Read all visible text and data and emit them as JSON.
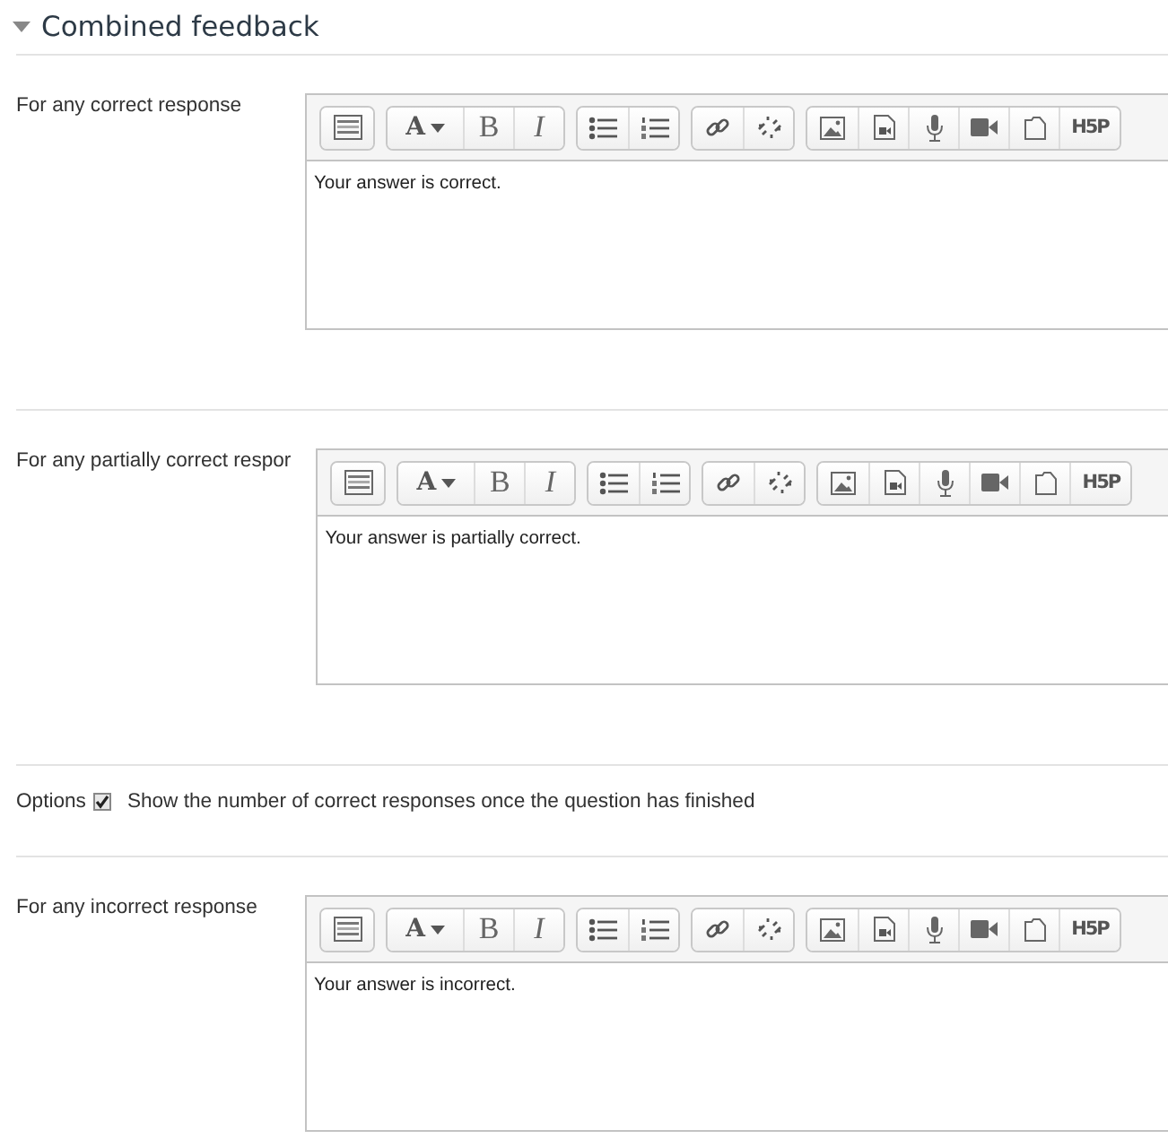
{
  "section": {
    "title": "Combined feedback",
    "expanded": true
  },
  "rows": [
    {
      "kind": "editor",
      "label": "For any correct response",
      "text": "Your answer is correct.",
      "toolbar": [
        [
          {
            "kind": "more"
          }
        ],
        [
          {
            "kind": "font",
            "label": "A"
          },
          {
            "kind": "bold",
            "label": "B"
          },
          {
            "kind": "italic",
            "label": "I"
          }
        ],
        [
          {
            "kind": "bullets"
          },
          {
            "kind": "numbers"
          }
        ],
        [
          {
            "kind": "link"
          },
          {
            "kind": "unlink"
          }
        ],
        [
          {
            "kind": "image"
          },
          {
            "kind": "media"
          },
          {
            "kind": "mic"
          },
          {
            "kind": "video"
          },
          {
            "kind": "files"
          },
          {
            "kind": "h5p",
            "label": "H5P"
          }
        ]
      ]
    },
    {
      "kind": "editor",
      "label": "For any partially correct respor",
      "text": "Your answer is partially correct.",
      "toolbar": [
        [
          {
            "kind": "more"
          }
        ],
        [
          {
            "kind": "font",
            "label": "A"
          },
          {
            "kind": "bold",
            "label": "B"
          },
          {
            "kind": "italic",
            "label": "I"
          }
        ],
        [
          {
            "kind": "bullets"
          },
          {
            "kind": "numbers"
          }
        ],
        [
          {
            "kind": "link"
          },
          {
            "kind": "unlink"
          }
        ],
        [
          {
            "kind": "image"
          },
          {
            "kind": "media"
          },
          {
            "kind": "mic"
          },
          {
            "kind": "video"
          },
          {
            "kind": "files"
          },
          {
            "kind": "h5p",
            "label": "H5P"
          }
        ]
      ]
    },
    {
      "kind": "checkbox",
      "label": "Options",
      "option": "Show the number of correct responses once the question has finished",
      "checked": true
    },
    {
      "kind": "editor",
      "label": "For any incorrect response",
      "text": "Your answer is incorrect.",
      "toolbar": [
        [
          {
            "kind": "more"
          }
        ],
        [
          {
            "kind": "font",
            "label": "A"
          },
          {
            "kind": "bold",
            "label": "B"
          },
          {
            "kind": "italic",
            "label": "I"
          }
        ],
        [
          {
            "kind": "bullets"
          },
          {
            "kind": "numbers"
          }
        ],
        [
          {
            "kind": "link"
          },
          {
            "kind": "unlink"
          }
        ],
        [
          {
            "kind": "image"
          },
          {
            "kind": "media"
          },
          {
            "kind": "mic"
          },
          {
            "kind": "video"
          },
          {
            "kind": "files"
          },
          {
            "kind": "h5p",
            "label": "H5P"
          }
        ]
      ]
    }
  ]
}
